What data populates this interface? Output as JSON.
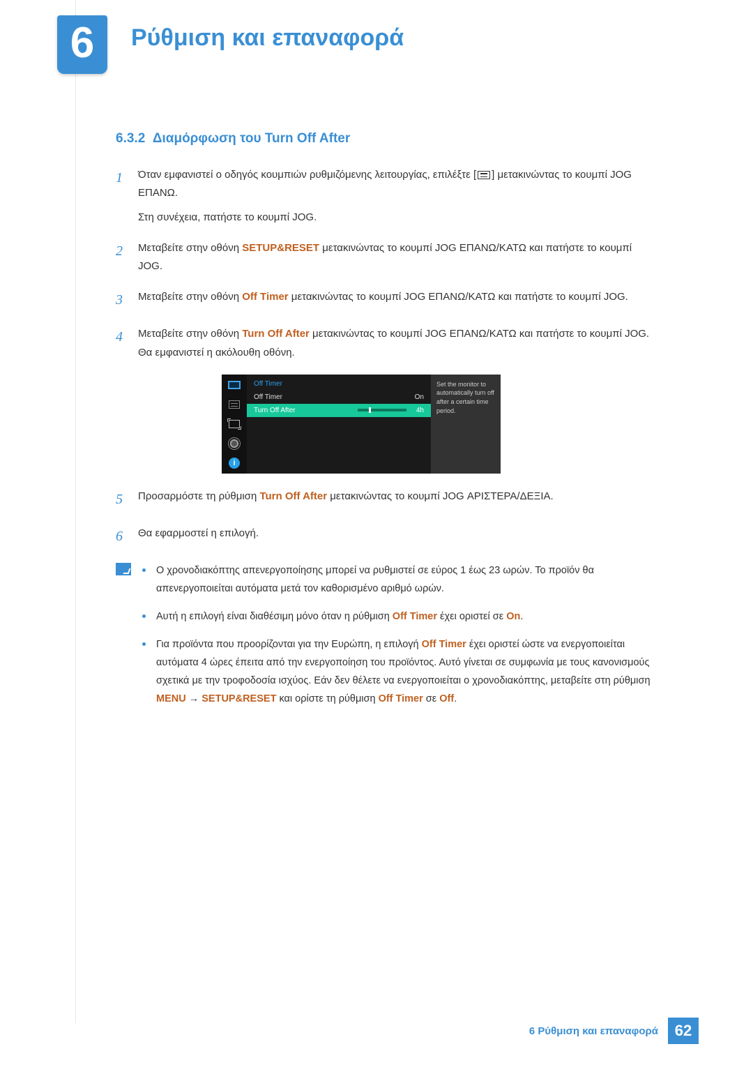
{
  "chapter": {
    "number": "6",
    "title": "Ρύθμιση και επαναφορά"
  },
  "section": {
    "number": "6.3.2",
    "title": "Διαμόρφωση του Turn Off After"
  },
  "steps": {
    "s1a": "Όταν εμφανιστεί ο οδηγός κουμπιών ρυθμιζόμενης λειτουργίας, επιλέξτε [",
    "s1b": "] μετακινώντας το κουμπί JOG ΕΠΑΝΩ.",
    "s1c": "Στη συνέχεια, πατήστε το κουμπί JOG.",
    "s2a": "Μεταβείτε στην οθόνη ",
    "s2hl": "SETUP&RESET",
    "s2b": " μετακινώντας το κουμπί JOG ΕΠΑΝΩ/ΚΑΤΩ και πατήστε το κουμπί JOG.",
    "s3a": "Μεταβείτε στην οθόνη ",
    "s3hl": "Off Timer",
    "s3b": " μετακινώντας το κουμπί JOG ΕΠΑΝΩ/ΚΑΤΩ και πατήστε το κουμπί JOG.",
    "s4a": "Μεταβείτε στην οθόνη ",
    "s4hl": "Turn Off After",
    "s4b": " μετακινώντας το κουμπί JOG ΕΠΑΝΩ/ΚΑΤΩ και πατήστε το κουμπί JOG. Θα εμφανιστεί η ακόλουθη οθόνη.",
    "s5a": "Προσαρμόστε τη ρύθμιση ",
    "s5hl": "Turn Off After",
    "s5b": " μετακινώντας το κουμπί JOG ΑΡΙΣΤΕΡΑ/ΔΕΞΙΑ.",
    "s6": "Θα εφαρμοστεί η επιλογή."
  },
  "osd": {
    "title": "Off Timer",
    "row1_label": "Off Timer",
    "row1_value": "On",
    "row2_label": "Turn Off After",
    "row2_value": "4h",
    "help": "Set the monitor to automatically turn off after a certain time period."
  },
  "notes": {
    "n1": "Ο χρονοδιακόπτης απενεργοποίησης μπορεί να ρυθμιστεί σε εύρος 1 έως 23 ωρών. Το προϊόν θα απενεργοποιείται αυτόματα μετά τον καθορισμένο αριθμό ωρών.",
    "n2a": "Αυτή η επιλογή είναι διαθέσιμη μόνο όταν η ρύθμιση ",
    "n2hl1": "Off Timer",
    "n2b": " έχει οριστεί σε ",
    "n2hl2": "On",
    "n2c": ".",
    "n3a": "Για προϊόντα που προορίζονται για την Ευρώπη, η επιλογή ",
    "n3hl1": "Off Timer",
    "n3b": " έχει οριστεί ώστε να ενεργοποιείται αυτόματα 4 ώρες έπειτα από την ενεργοποίηση του προϊόντος. Αυτό γίνεται σε συμφωνία με τους κανονισμούς σχετικά με την τροφοδοσία ισχύος. Εάν δεν θέλετε να ενεργοποιείται ο χρονοδιακόπτης, μεταβείτε στη ρύθμιση ",
    "n3hl2": "MENU",
    "n3arrow": " → ",
    "n3hl3": "SETUP&RESET",
    "n3c": " και ορίστε τη ρύθμιση ",
    "n3hl4": "Off Timer",
    "n3d": " σε ",
    "n3hl5": "Off",
    "n3e": "."
  },
  "footer": {
    "text": "6 Ρύθμιση και επαναφορά",
    "page": "62"
  },
  "nums": {
    "n1": "1",
    "n2": "2",
    "n3": "3",
    "n4": "4",
    "n5": "5",
    "n6": "6"
  }
}
